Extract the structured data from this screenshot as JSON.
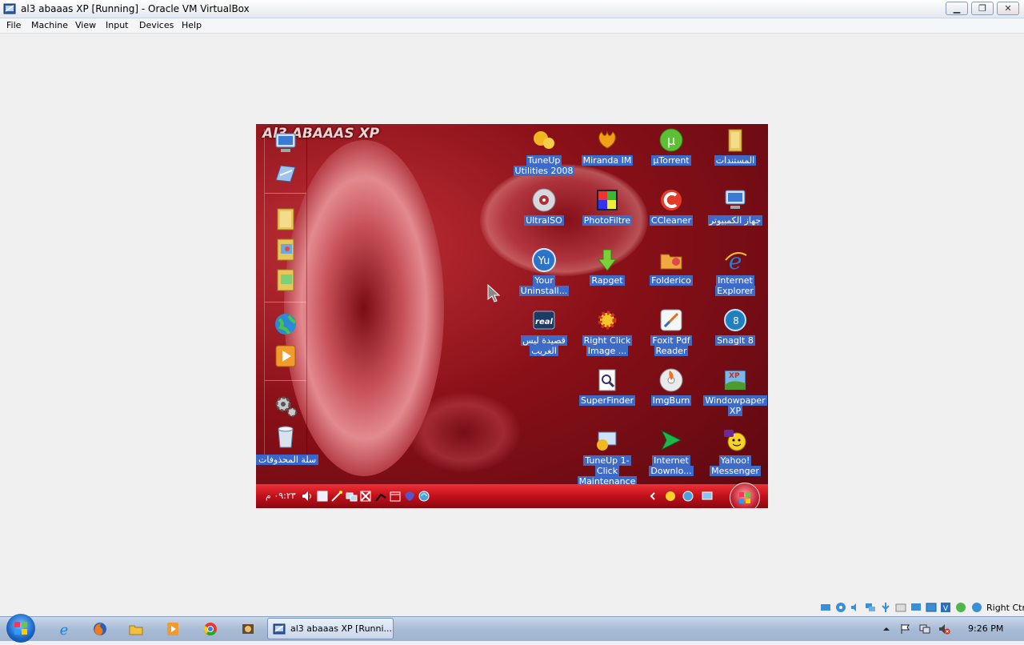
{
  "window": {
    "title": "al3 abaaas XP [Running] - Oracle VM VirtualBox",
    "min_glyph": "▁",
    "max_glyph": "❐",
    "close_glyph": "✕"
  },
  "menu": [
    "File",
    "Machine",
    "View",
    "Input",
    "Devices",
    "Help"
  ],
  "guest": {
    "brand_text": "Al3 ABAAAS XP",
    "recycle_bin_label": "سلة المحذوفات",
    "desktop_icons": [
      {
        "label": "TuneUp Utilities 2008",
        "icon": "tuneup-icon"
      },
      {
        "label": "Miranda IM",
        "icon": "miranda-icon"
      },
      {
        "label": "µTorrent",
        "icon": "utorrent-icon"
      },
      {
        "label": "المستندات",
        "icon": "documents-folder-icon"
      },
      {
        "label": "UltraISO",
        "icon": "ultraiso-icon"
      },
      {
        "label": "PhotoFiltre",
        "icon": "photofiltre-icon"
      },
      {
        "label": "CCleaner",
        "icon": "ccleaner-icon"
      },
      {
        "label": "جهاز الكمبيوتر",
        "icon": "my-computer-icon"
      },
      {
        "label": "Your Uninstall...",
        "icon": "your-uninstaller-icon"
      },
      {
        "label": "Rapget",
        "icon": "rapget-icon"
      },
      {
        "label": "Folderico",
        "icon": "folderico-icon"
      },
      {
        "label": "Internet Explorer",
        "icon": "internet-explorer-icon"
      },
      {
        "label": "قصيدة ليس الغريب",
        "icon": "realplayer-icon"
      },
      {
        "label": "Right Click Image ...",
        "icon": "right-click-image-icon"
      },
      {
        "label": "Foxit Pdf Reader",
        "icon": "foxit-reader-icon"
      },
      {
        "label": "SnagIt 8",
        "icon": "snagit-icon"
      },
      {
        "label": "SuperFinder",
        "icon": "superfinder-icon"
      },
      {
        "label": "ImgBurn",
        "icon": "imgburn-icon"
      },
      {
        "label": "Windowpaper XP",
        "icon": "windowpaper-icon"
      },
      {
        "label": "TuneUp 1-Click Maintenance",
        "icon": "tuneup-maintenance-icon"
      },
      {
        "label": "Internet Downlo...",
        "icon": "internet-download-manager-icon"
      },
      {
        "label": "Yahoo! Messenger",
        "icon": "yahoo-messenger-icon"
      }
    ],
    "taskbar_clock": "٠٩:٢٣ م"
  },
  "vbox_status": {
    "host_key": "Right Ctrl"
  },
  "host_taskbar": {
    "task_title": "al3 abaaas XP [Runni...",
    "clock": "9:26 PM"
  },
  "colors": {
    "desktop_red": "#8a1018",
    "label_highlight": "#3f6bc8",
    "vm_taskbar_red": "#c0101a"
  }
}
